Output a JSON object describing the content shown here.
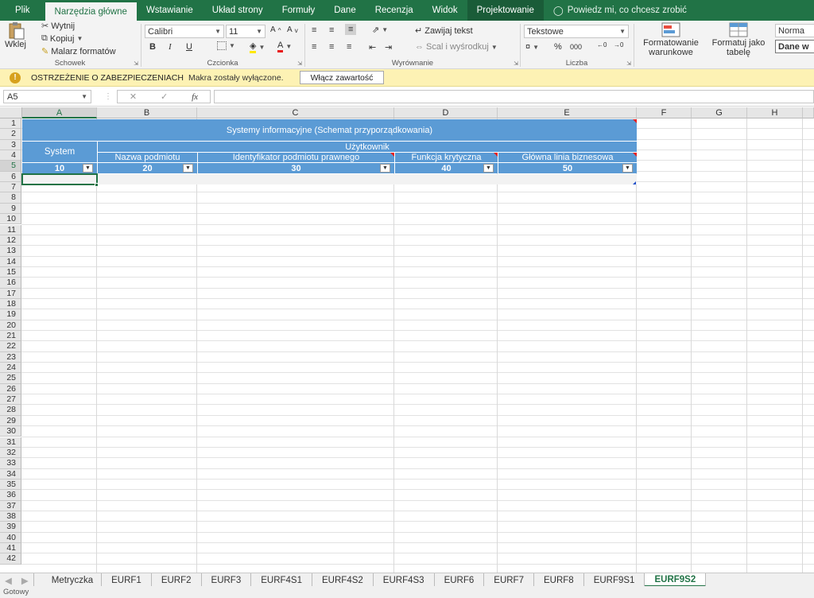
{
  "tabs": [
    {
      "label": "Plik",
      "name": "tab-file"
    },
    {
      "label": "Narzędzia główne",
      "name": "tab-home",
      "active": true
    },
    {
      "label": "Wstawianie",
      "name": "tab-insert"
    },
    {
      "label": "Układ strony",
      "name": "tab-page-layout"
    },
    {
      "label": "Formuły",
      "name": "tab-formulas"
    },
    {
      "label": "Dane",
      "name": "tab-data"
    },
    {
      "label": "Recenzja",
      "name": "tab-review"
    },
    {
      "label": "Widok",
      "name": "tab-view"
    },
    {
      "label": "Projektowanie",
      "name": "tab-design"
    }
  ],
  "tell_me": "Powiedz mi, co chcesz zrobić",
  "ribbon": {
    "clipboard": {
      "paste": "Wklej",
      "cut": "Wytnij",
      "copy": "Kopiuj",
      "format_painter": "Malarz formatów",
      "label": "Schowek"
    },
    "font": {
      "name": "Calibri",
      "size": "11",
      "label": "Czcionka",
      "bold": "B",
      "italic": "I",
      "underline": "U"
    },
    "alignment": {
      "wrap": "Zawijaj tekst",
      "merge": "Scal i wyśrodkuj",
      "label": "Wyrównanie"
    },
    "number": {
      "format": "Tekstowe",
      "label": "Liczba",
      "percent": "%",
      "thousands": "000"
    },
    "styles": {
      "conditional": "Formatowanie warunkowe",
      "table": "Formatuj jako tabelę",
      "normal": "Norma",
      "data_input": "Dane w"
    }
  },
  "security": {
    "title": "OSTRZEŻENIE O ZABEZPIECZENIACH",
    "message": "Makra zostały wyłączone.",
    "button": "Włącz zawartość"
  },
  "formula_bar": {
    "namebox": "A5",
    "fx": "fx",
    "value": ""
  },
  "columns": [
    "A",
    "B",
    "C",
    "D",
    "E",
    "F",
    "G",
    "H"
  ],
  "rows": [
    "1",
    "2",
    "3",
    "4",
    "5",
    "6",
    "7",
    "8",
    "9",
    "10",
    "11",
    "12",
    "13",
    "14",
    "15",
    "16",
    "17",
    "18",
    "19",
    "20",
    "21",
    "22",
    "23",
    "24",
    "25",
    "26",
    "27",
    "28",
    "29",
    "30",
    "31",
    "32",
    "33",
    "34",
    "35",
    "36",
    "37",
    "38",
    "39",
    "40",
    "41",
    "42"
  ],
  "table": {
    "title": "Systemy informacyjne (Schemat przyporządkowania)",
    "system": "System",
    "user": "Użytkownik",
    "entity_name": "Nazwa podmiotu",
    "legal_id": "Identyfikator podmiotu prawnego",
    "critical_function": "Funkcja krytyczna",
    "business_line": "Główna linia biznesowa",
    "codes": [
      "10",
      "20",
      "30",
      "40",
      "50"
    ]
  },
  "sheets": [
    "Metryczka",
    "EURF1",
    "EURF2",
    "EURF3",
    "EURF4S1",
    "EURF4S2",
    "EURF4S3",
    "EURF6",
    "EURF7",
    "EURF8",
    "EURF9S1",
    "EURF9S2"
  ],
  "active_sheet": "EURF9S2",
  "status": "Gotowy",
  "colors": {
    "accent": "#217346",
    "table": "#5b9bd5",
    "warning": "#fdf2b4"
  }
}
